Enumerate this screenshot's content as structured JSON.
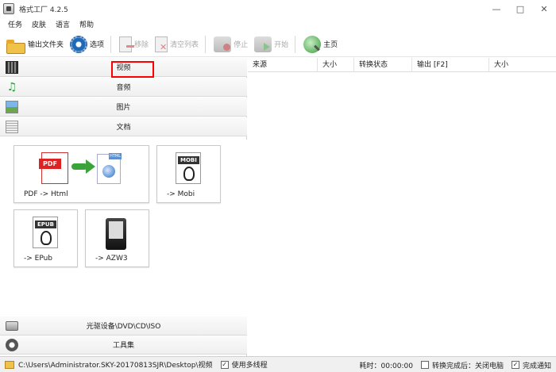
{
  "window": {
    "title": "格式工厂 4.2.5",
    "controls": {
      "minimize": "—",
      "maximize": "□",
      "close": "✕"
    }
  },
  "menu": {
    "items": [
      "任务",
      "皮肤",
      "语言",
      "帮助"
    ]
  },
  "toolbar": {
    "output_folder": "输出文件夹",
    "options": "选项",
    "remove": "移除",
    "clear_list": "清空列表",
    "stop": "停止",
    "start": "开始",
    "home": "主页"
  },
  "categories": {
    "video": "视频",
    "audio": "音频",
    "image": "图片",
    "document": "文档",
    "disc": "光驱设备\\DVD\\CD\\ISO",
    "tools": "工具集"
  },
  "document_tools": [
    {
      "label": "PDF -> Html"
    },
    {
      "label": "-> Mobi",
      "tag": "MOBI"
    },
    {
      "label": "-> EPub",
      "tag": "EPUB"
    },
    {
      "label": "-> AZW3"
    }
  ],
  "task_list": {
    "columns": [
      "来源",
      "大小",
      "转换状态",
      "输出 [F2]",
      "大小"
    ]
  },
  "statusbar": {
    "output_path": "C:\\Users\\Administrator.SKY-20170813SJR\\Desktop\\视频",
    "multithread_label": "使用多线程",
    "multithread_checked": "✓",
    "elapsed": "耗时：00:00:00",
    "after_convert_label": "转换完成后：关闭电脑",
    "notify_label": "完成通知",
    "notify_checked": "✓"
  }
}
